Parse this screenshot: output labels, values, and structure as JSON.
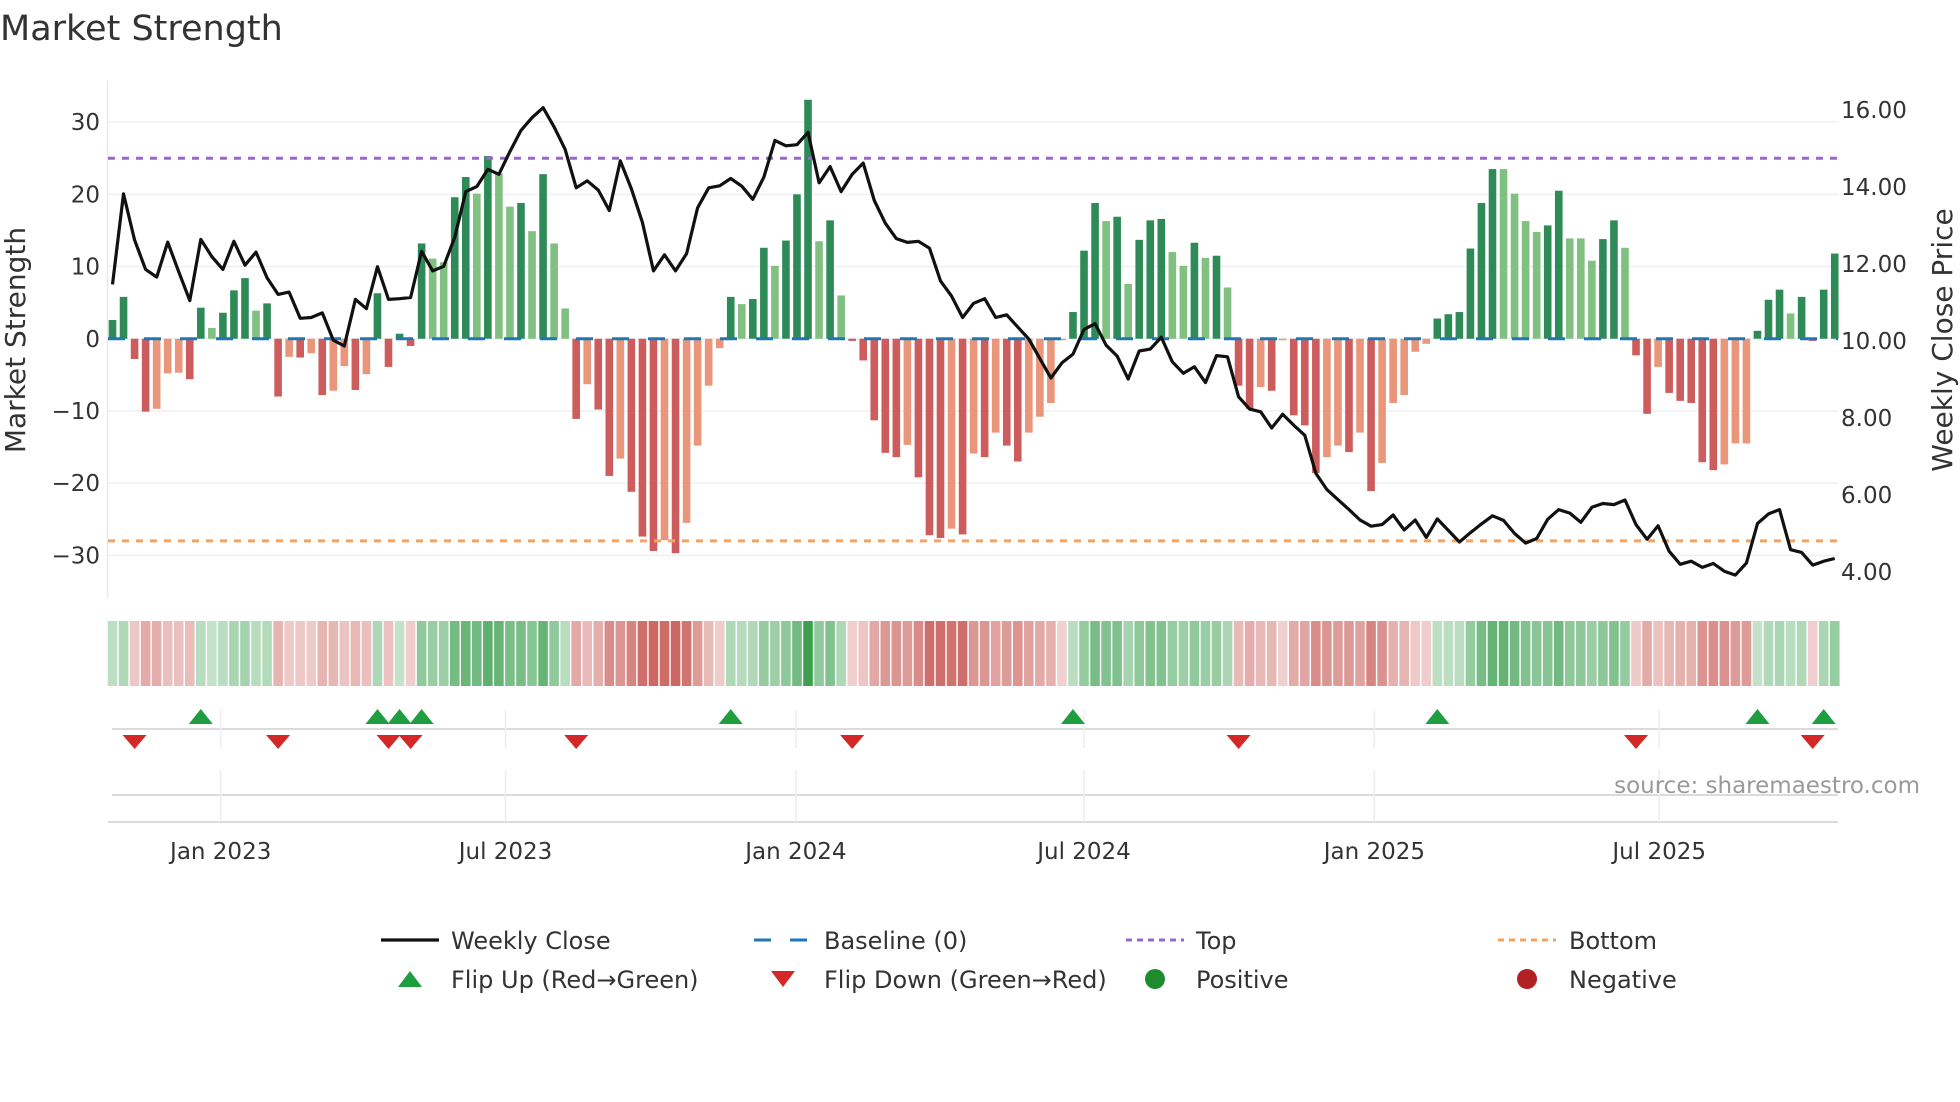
{
  "title": "Market Strength",
  "source": "source: sharemaestro.com",
  "colors": {
    "pos_strong": "#2e8b57",
    "pos_weak": "#80c080",
    "neg_strong": "#cd5c5c",
    "neg_weak": "#e9967a",
    "close_line": "#111111",
    "baseline": "#1f77b4",
    "top": "#9966cc",
    "bottom": "#f4a460",
    "flip_up": "#1f9e3f",
    "flip_down": "#d62728",
    "positive": "#1e8c2e",
    "negative": "#b22222",
    "heat_pos": "#3ca050",
    "heat_neg": "#c85a55"
  },
  "chart_data": {
    "type": "bar",
    "title": "Market Strength",
    "ylabel": "Market Strength",
    "y2label": "Weekly Close Price",
    "ylim": [
      -35,
      36
    ],
    "y2lim": [
      3.3,
      16.6
    ],
    "yticks": [
      "30",
      "20",
      "10",
      "0",
      "−10",
      "−20",
      "−30"
    ],
    "ytick_values": [
      30,
      20,
      10,
      0,
      -10,
      -20,
      -30
    ],
    "y2ticks": [
      "16.00",
      "14.00",
      "12.00",
      "10.00",
      "8.00",
      "6.00",
      "4.00"
    ],
    "y2tick_values": [
      16,
      14,
      12,
      10,
      8,
      6,
      4
    ],
    "x_ticks": [
      {
        "label": "Jan 2023",
        "week_index": 9.8
      },
      {
        "label": "Jul 2023",
        "week_index": 35.6
      },
      {
        "label": "Jan 2024",
        "week_index": 61.9
      },
      {
        "label": "Jul 2024",
        "week_index": 88.0
      },
      {
        "label": "Jan 2025",
        "week_index": 114.3
      },
      {
        "label": "Jul 2025",
        "week_index": 140.1
      }
    ],
    "top_level": 25,
    "bottom_level": -28,
    "baseline": 0,
    "grid": true,
    "strength": [
      2.6,
      5.8,
      -2.8,
      -10.1,
      -9.7,
      -4.8,
      -4.7,
      -5.6,
      4.3,
      1.5,
      3.6,
      6.7,
      8.4,
      3.9,
      4.9,
      -8.0,
      -2.5,
      -2.6,
      -2.0,
      -7.8,
      -7.2,
      -3.8,
      -7.1,
      -4.9,
      6.3,
      -3.9,
      0.7,
      -1.0,
      13.2,
      11.1,
      10.6,
      19.6,
      22.4,
      20.1,
      25.3,
      22.9,
      18.3,
      18.8,
      14.9,
      22.8,
      13.2,
      4.2,
      -11.1,
      -6.3,
      -9.8,
      -19.0,
      -16.6,
      -21.2,
      -27.4,
      -29.4,
      -27.9,
      -29.7,
      -25.5,
      -14.8,
      -6.5,
      -1.3,
      5.8,
      4.8,
      5.5,
      12.6,
      10.1,
      13.6,
      20.0,
      33.1,
      13.5,
      16.4,
      6.0,
      -0.3,
      -3.0,
      -11.3,
      -15.8,
      -16.4,
      -14.7,
      -19.2,
      -27.2,
      -27.6,
      -26.3,
      -27.1,
      -15.9,
      -16.4,
      -13.0,
      -14.8,
      -17.0,
      -13.0,
      -10.8,
      -8.9,
      -0.2,
      3.7,
      12.2,
      18.8,
      16.3,
      16.9,
      7.6,
      13.7,
      16.4,
      16.6,
      12.0,
      10.1,
      13.3,
      11.2,
      11.5,
      7.1,
      -6.5,
      -9.7,
      -6.7,
      -7.2,
      -0.2,
      -10.6,
      -12.0,
      -18.6,
      -16.4,
      -14.8,
      -15.7,
      -13.0,
      -21.1,
      -17.2,
      -8.9,
      -7.8,
      -1.8,
      -0.7,
      2.8,
      3.4,
      3.7,
      12.5,
      18.8,
      23.5,
      23.5,
      20.1,
      16.3,
      14.8,
      15.7,
      20.5,
      13.9,
      13.9,
      10.8,
      13.8,
      16.4,
      12.6,
      -2.3,
      -10.4,
      -3.9,
      -7.5,
      -8.6,
      -8.9,
      -17.1,
      -18.2,
      -17.4,
      -14.5,
      -14.5,
      1.1,
      5.4,
      6.8,
      3.5,
      5.8,
      -0.3,
      6.8,
      11.8
    ],
    "weekly_close": [
      11.47,
      13.82,
      12.62,
      11.86,
      11.66,
      12.57,
      11.8,
      11.05,
      12.64,
      12.19,
      11.86,
      12.59,
      11.97,
      12.31,
      11.64,
      11.21,
      11.27,
      10.59,
      10.61,
      10.73,
      10.02,
      9.87,
      11.08,
      10.84,
      11.93,
      11.08,
      11.1,
      11.13,
      12.33,
      11.82,
      11.94,
      12.69,
      13.88,
      14.01,
      14.46,
      14.33,
      14.92,
      15.47,
      15.8,
      16.06,
      15.56,
      14.98,
      13.98,
      14.16,
      13.92,
      13.39,
      14.68,
      13.95,
      13.08,
      11.82,
      12.24,
      11.82,
      12.27,
      13.46,
      13.98,
      14.03,
      14.22,
      14.02,
      13.68,
      14.26,
      15.21,
      15.07,
      15.1,
      15.42,
      14.11,
      14.53,
      13.88,
      14.33,
      14.62,
      13.65,
      13.06,
      12.66,
      12.56,
      12.59,
      12.41,
      11.56,
      11.17,
      10.61,
      10.98,
      11.1,
      10.61,
      10.68,
      10.36,
      10.05,
      9.54,
      9.04,
      9.43,
      9.66,
      10.3,
      10.45,
      9.89,
      9.61,
      9.01,
      9.74,
      9.79,
      10.1,
      9.46,
      9.16,
      9.33,
      8.92,
      9.62,
      9.59,
      8.55,
      8.23,
      8.16,
      7.74,
      8.1,
      7.81,
      7.55,
      6.56,
      6.14,
      5.88,
      5.62,
      5.35,
      5.19,
      5.23,
      5.48,
      5.09,
      5.35,
      4.9,
      5.38,
      5.08,
      4.78,
      5.02,
      5.25,
      5.46,
      5.34,
      5.0,
      4.75,
      4.87,
      5.37,
      5.62,
      5.53,
      5.29,
      5.68,
      5.78,
      5.75,
      5.87,
      5.23,
      4.85,
      5.2,
      4.54,
      4.2,
      4.28,
      4.12,
      4.22,
      4.02,
      3.92,
      4.23,
      5.26,
      5.51,
      5.62,
      4.58,
      4.51,
      4.18,
      4.28,
      4.35
    ],
    "legend": {
      "placement": "bottom",
      "items": [
        {
          "key": "weekly_close",
          "label": "Weekly Close",
          "symbol": "line"
        },
        {
          "key": "baseline",
          "label": "Baseline (0)",
          "symbol": "dash"
        },
        {
          "key": "top",
          "label": "Top",
          "symbol": "dot"
        },
        {
          "key": "bottom",
          "label": "Bottom",
          "symbol": "dot"
        },
        {
          "key": "flip_up",
          "label": "Flip Up (Red→Green)",
          "symbol": "triangle-up"
        },
        {
          "key": "flip_down",
          "label": "Flip Down (Green→Red)",
          "symbol": "triangle-down"
        },
        {
          "key": "positive",
          "label": "Positive",
          "symbol": "circle"
        },
        {
          "key": "negative",
          "label": "Negative",
          "symbol": "circle"
        }
      ]
    }
  }
}
